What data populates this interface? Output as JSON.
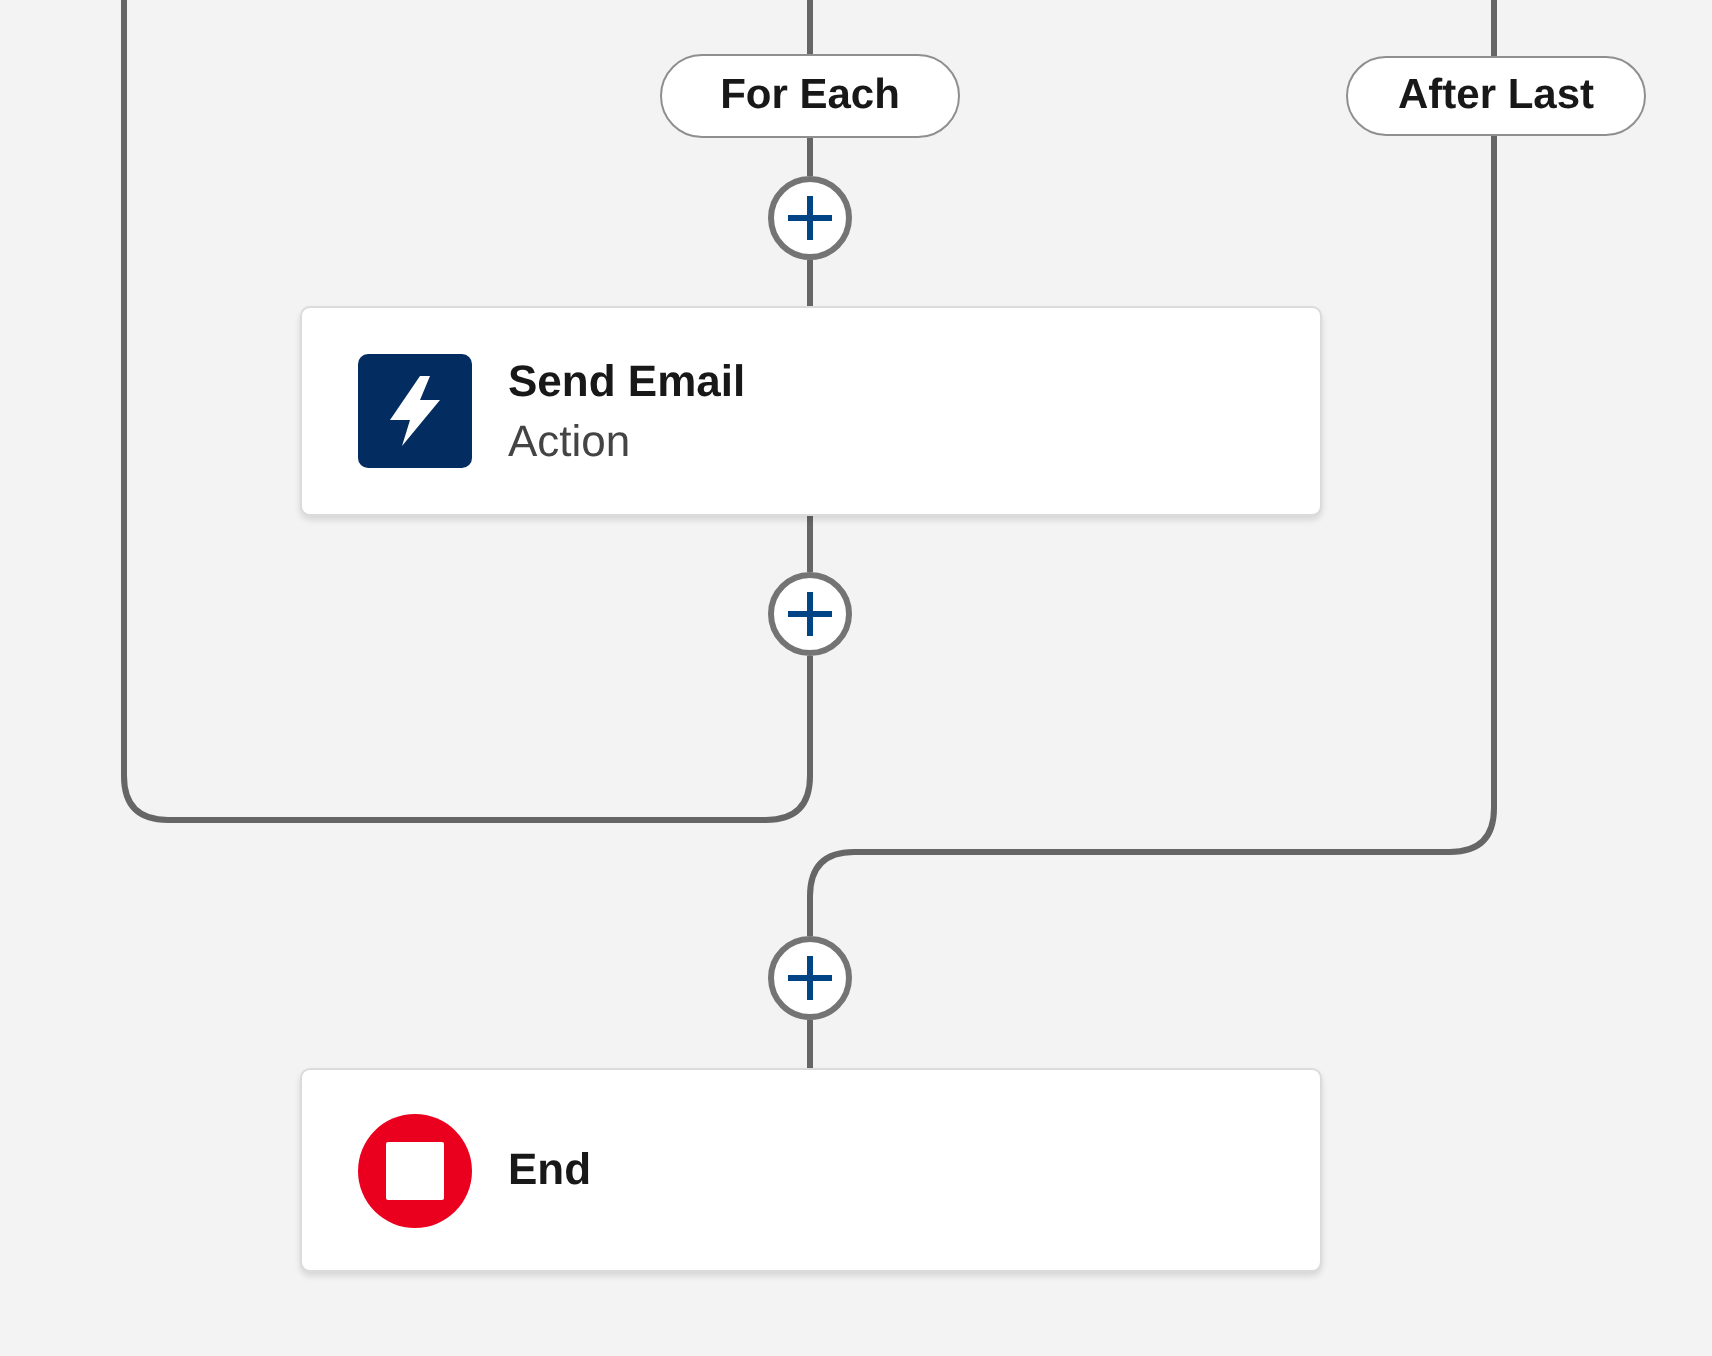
{
  "canvas": {
    "branches": [
      {
        "label": "For Each"
      },
      {
        "label": "After Last"
      }
    ],
    "nodes": [
      {
        "kind": "action",
        "title": "Send Email",
        "subtitle": "Action"
      },
      {
        "kind": "end",
        "title": "End"
      }
    ]
  }
}
